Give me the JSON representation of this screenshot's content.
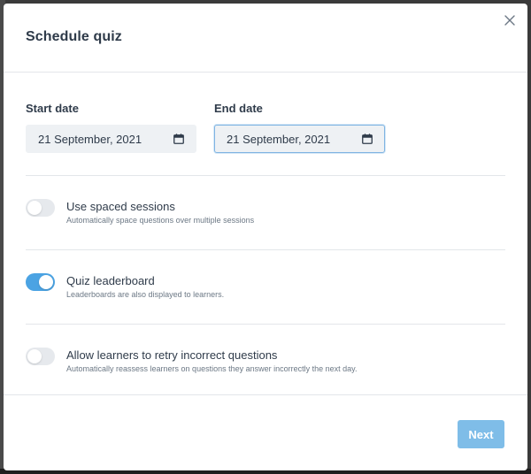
{
  "dialog": {
    "title": "Schedule quiz",
    "close_icon": "close-icon"
  },
  "dates": {
    "start": {
      "label": "Start date",
      "value": "21 September, 2021",
      "icon": "calendar-icon"
    },
    "end": {
      "label": "End date",
      "value": "21 September, 2021",
      "icon": "calendar-icon",
      "focused": true
    }
  },
  "options": [
    {
      "title": "Use spaced sessions",
      "description": "Automatically space questions over multiple sessions",
      "enabled": false
    },
    {
      "title": "Quiz leaderboard",
      "description": "Leaderboards are also displayed to learners.",
      "enabled": true
    },
    {
      "title": "Allow learners to retry incorrect questions",
      "description": "Automatically reassess learners on questions they answer incorrectly the next day.",
      "enabled": false
    }
  ],
  "footer": {
    "next_label": "Next"
  },
  "colors": {
    "accent": "#4ba3e3",
    "button": "#7fbde8",
    "text": "#2f3b4a",
    "muted": "#6c7885"
  }
}
